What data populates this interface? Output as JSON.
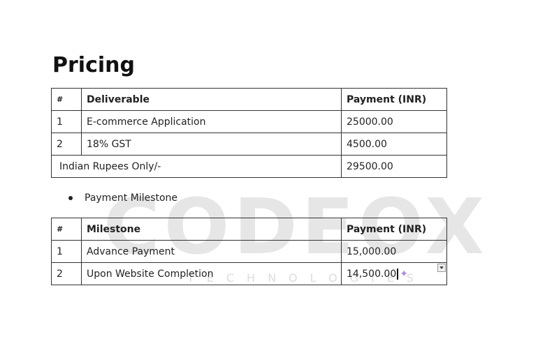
{
  "title": "Pricing",
  "pricing_table": {
    "headers": [
      "#",
      "Deliverable",
      "Payment (INR)"
    ],
    "rows": [
      [
        "1",
        "E-commerce Application",
        "25000.00"
      ],
      [
        "2",
        "18% GST",
        "4500.00"
      ]
    ],
    "total_label": "Indian Rupees Only/-",
    "total_value": "29500.00"
  },
  "bullet": "Payment Milestone",
  "milestone_table": {
    "headers": [
      "#",
      "Milestone",
      "Payment (INR)"
    ],
    "rows": [
      [
        "1",
        "Advance Payment",
        "15,000.00"
      ],
      [
        "2",
        "Upon Website Completion",
        "14,500.00"
      ]
    ]
  },
  "watermark": {
    "text": "CODEOX",
    "subtext": "TECHNOLOGIES"
  },
  "icons": [
    "sparkle-icon",
    "dropdown-arrow-icon"
  ]
}
